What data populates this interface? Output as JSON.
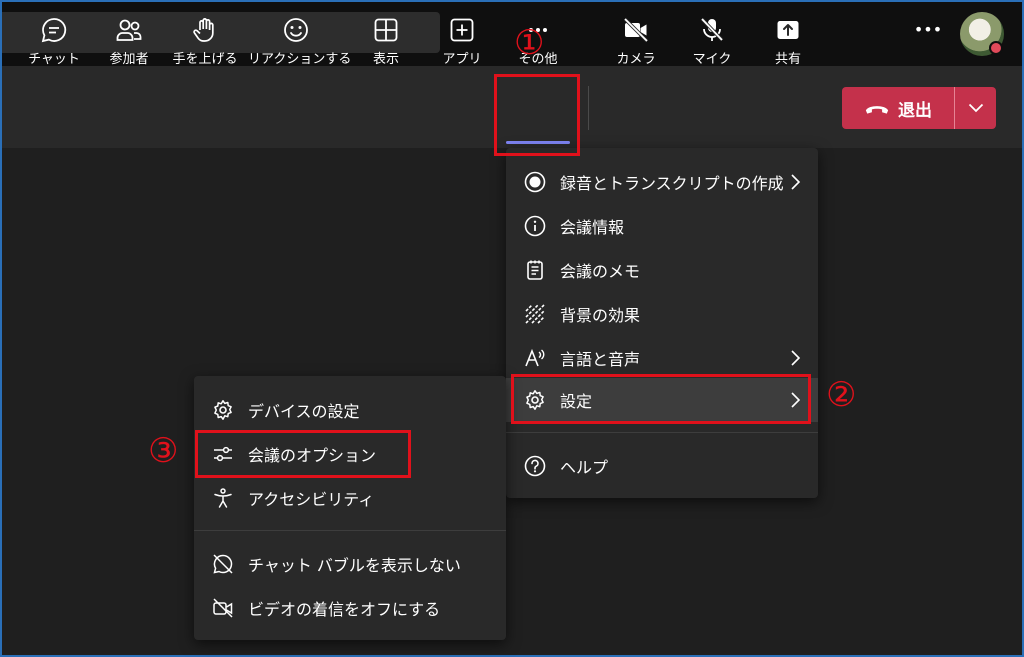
{
  "toolbar": {
    "items": [
      {
        "label": "チャット",
        "icon": "chat-icon"
      },
      {
        "label": "参加者",
        "icon": "people-icon"
      },
      {
        "label": "手を上げる",
        "icon": "raise-hand-icon"
      },
      {
        "label": "リアクションする",
        "icon": "smiley-icon"
      },
      {
        "label": "表示",
        "icon": "view-grid-icon"
      },
      {
        "label": "アプリ",
        "icon": "apps-plus-icon"
      },
      {
        "label": "その他",
        "icon": "more-dots-icon"
      },
      {
        "label": "カメラ",
        "icon": "camera-off-icon"
      },
      {
        "label": "マイク",
        "icon": "mic-off-icon"
      },
      {
        "label": "共有",
        "icon": "share-icon"
      }
    ],
    "leave_label": "退出"
  },
  "more_menu": {
    "items": [
      {
        "label": "録音とトランスクリプトの作成",
        "icon": "record-icon",
        "submenu": true
      },
      {
        "label": "会議情報",
        "icon": "info-icon",
        "submenu": false
      },
      {
        "label": "会議のメモ",
        "icon": "notes-icon",
        "submenu": false
      },
      {
        "label": "背景の効果",
        "icon": "background-effects-icon",
        "submenu": false
      },
      {
        "label": "言語と音声",
        "icon": "language-icon",
        "submenu": true
      },
      {
        "label": "設定",
        "icon": "gear-icon",
        "submenu": true
      },
      {
        "label": "ヘルプ",
        "icon": "help-icon",
        "submenu": false
      }
    ]
  },
  "settings_menu": {
    "items": [
      {
        "label": "デバイスの設定",
        "icon": "gear-icon"
      },
      {
        "label": "会議のオプション",
        "icon": "sliders-icon"
      },
      {
        "label": "アクセシビリティ",
        "icon": "accessibility-icon"
      },
      {
        "label": "チャット バブルを表示しない",
        "icon": "chat-bubble-off-icon"
      },
      {
        "label": "ビデオの着信をオフにする",
        "icon": "video-off-icon"
      }
    ]
  },
  "annotations": {
    "step1": "①",
    "step2": "②",
    "step3": "③"
  },
  "colors": {
    "highlight_red": "#e0111b",
    "leave_button": "#c4314b",
    "active_underline": "#7f85f5",
    "menu_bg": "#292929"
  }
}
